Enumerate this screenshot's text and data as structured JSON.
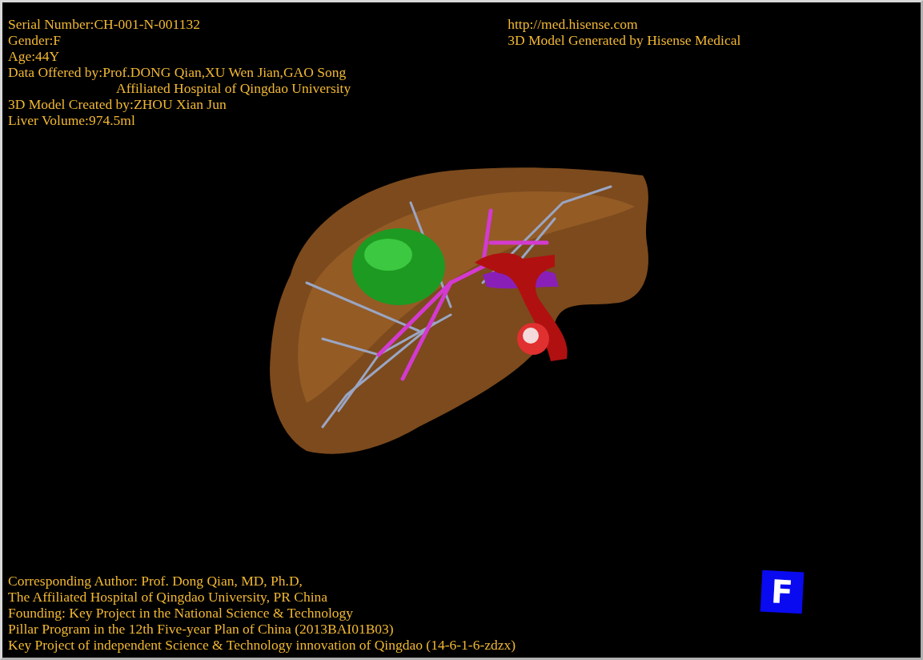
{
  "info_top_left": [
    {
      "text": "Serial Number:CH-001-N-001132",
      "kind": "plain"
    },
    {
      "text": "Gender:F",
      "kind": "plain"
    },
    {
      "text": "Age:44Y",
      "kind": "plain"
    },
    {
      "text": "Data Offered by:Prof.DONG Qian,XU Wen Jian,GAO Song",
      "kind": "plain"
    },
    {
      "text": "Affiliated Hospital of Qingdao University",
      "kind": "indent"
    },
    {
      "text": "3D Model Created by:ZHOU Xian Jun",
      "kind": "plain"
    },
    {
      "text": "Liver Volume:974.5ml",
      "kind": "plain"
    }
  ],
  "info_top_right": [
    {
      "text": "http://med.hisense.com",
      "kind": "plain"
    },
    {
      "text": "3D Model Generated by Hisense Medical",
      "kind": "plain"
    }
  ],
  "model": {
    "kind": "liver"
  },
  "info_bottom": [
    {
      "text": "Corresponding Author: Prof. Dong Qian, MD, Ph.D,",
      "kind": "plain"
    },
    {
      "text": "The Affiliated Hospital of Qingdao University, PR China",
      "kind": "plain"
    },
    {
      "text": "Founding: Key Project in the National Science & Technology",
      "kind": "plain"
    },
    {
      "text": "Pillar Program in the 12th Five-year Plan of China (2013BAI01B03)",
      "kind": "plain"
    },
    {
      "text": "Key Project of independent Science & Technology innovation of Qingdao (14-6-1-6-zdzx)",
      "kind": "plain"
    }
  ],
  "orientation_cube": {
    "label": "F"
  }
}
